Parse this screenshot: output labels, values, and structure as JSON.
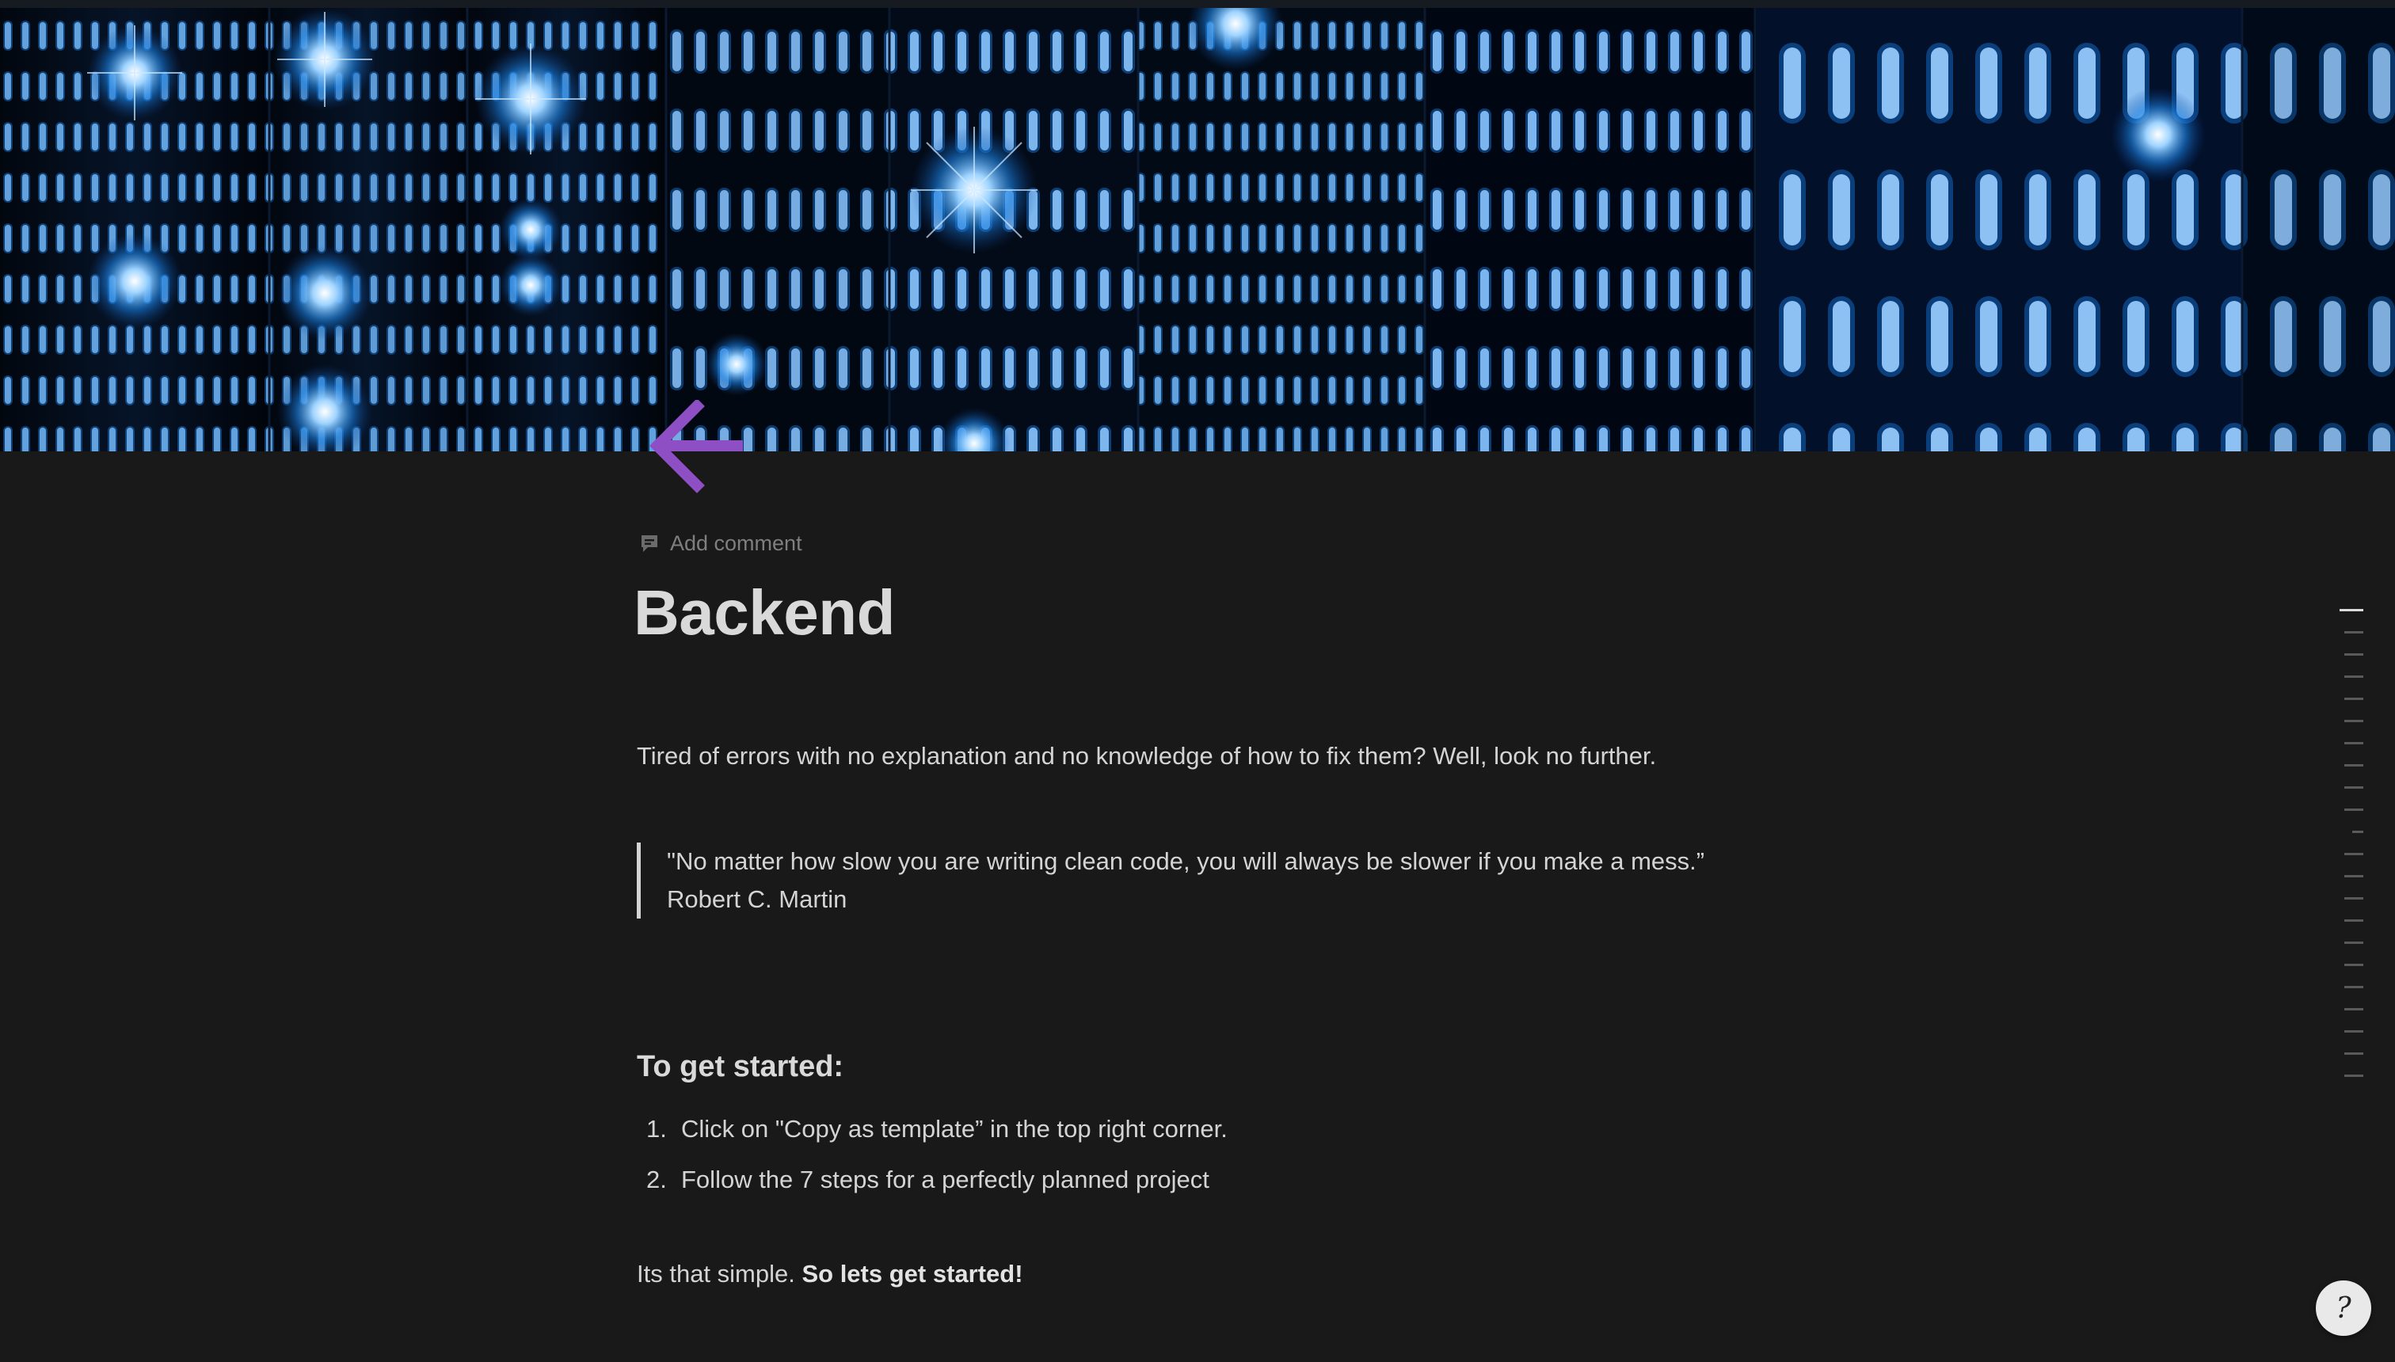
{
  "page": {
    "title": "Backend",
    "add_comment": "Add comment"
  },
  "icons": {
    "page_icon": "arrow-left-icon",
    "page_icon_color": "#8e4fc4",
    "comment": "comment-icon",
    "help": "help-icon"
  },
  "content": {
    "intro": "Tired of errors with no explanation and no knowledge of how to fix them? Well, look no further.",
    "quote_text": "\"No matter how slow you are writing clean code, you will always be slower if you make a mess.”",
    "quote_author": "Robert C. Martin",
    "heading": "To get started:",
    "steps": [
      {
        "num": "1.",
        "text": "Click on \"Copy as template” in the top right corner."
      },
      {
        "num": "2.",
        "text": "Follow the 7 steps for a perfectly planned project"
      }
    ],
    "final_plain": "Its that simple. ",
    "final_bold": "So lets get started!"
  },
  "help": {
    "glyph": "?"
  },
  "colors": {
    "background": "#191919",
    "cover_accent": "#1a8cff"
  }
}
